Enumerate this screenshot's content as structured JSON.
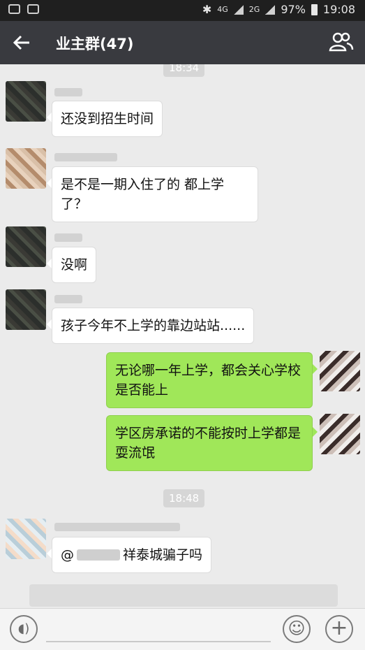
{
  "status_bar": {
    "network": "4G",
    "network_2": "2G",
    "battery": "97%",
    "time": "19:08"
  },
  "header": {
    "back_icon": "back-arrow-icon",
    "title": "业主群(47)",
    "members_icon": "people-icon"
  },
  "chat": {
    "timestamps": [
      "18:34",
      "18:48"
    ],
    "messages": [
      {
        "side": "in",
        "text": "还没到招生时间"
      },
      {
        "side": "in",
        "text": "是不是一期入住了的 都上学了？"
      },
      {
        "side": "in",
        "text": "没啊"
      },
      {
        "side": "in",
        "text": "孩子今年不上学的靠边站站......"
      },
      {
        "side": "out",
        "text": "无论哪一年上学，都会关心学校是否能上"
      },
      {
        "side": "out",
        "text": "学区房承诺的不能按时上学都是耍流氓"
      },
      {
        "side": "in",
        "mention": "@",
        "text": "祥泰城骗子吗"
      }
    ]
  },
  "input_bar": {
    "voice_icon": "voice-icon",
    "emoji_icon": "emoji-icon",
    "plus_icon": "plus-icon"
  }
}
